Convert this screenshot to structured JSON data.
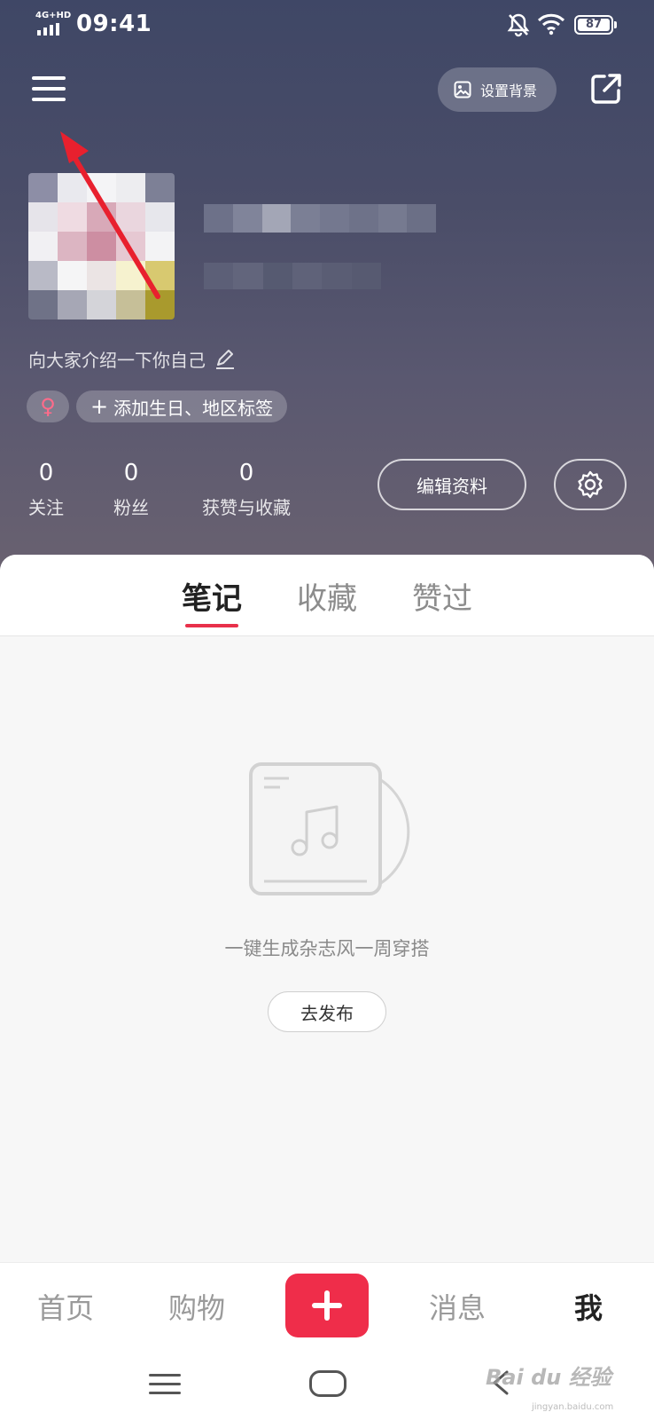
{
  "status_bar": {
    "network": "4G+HD",
    "time": "09:41",
    "battery": "87",
    "icons": [
      "mute-bell-icon",
      "wifi-icon",
      "battery-icon"
    ]
  },
  "header": {
    "menu_icon": "hamburger-menu-icon",
    "set_background_label": "设置背景",
    "share_icon": "share-external-icon"
  },
  "profile": {
    "bio": "向大家介绍一下你自己",
    "gender_symbol": "♀",
    "add_tags_label": "添加生日、地区标签",
    "stats": [
      {
        "value": "0",
        "label": "关注"
      },
      {
        "value": "0",
        "label": "粉丝"
      },
      {
        "value": "0",
        "label": "获赞与收藏"
      }
    ],
    "edit_label": "编辑资料",
    "settings_icon": "gear-icon"
  },
  "tabs": [
    {
      "label": "笔记",
      "active": true
    },
    {
      "label": "收藏",
      "active": false
    },
    {
      "label": "赞过",
      "active": false
    }
  ],
  "empty_state": {
    "icon": "music-album-icon",
    "text": "一键生成杂志风一周穿搭",
    "button_label": "去发布"
  },
  "bottom_nav": [
    {
      "label": "首页",
      "active": false
    },
    {
      "label": "购物",
      "active": false
    },
    {
      "label": "+",
      "active": false
    },
    {
      "label": "消息",
      "active": false
    },
    {
      "label": "我",
      "active": true
    }
  ],
  "watermark": {
    "text": "Bai du 经验",
    "sub": "jingyan.baidu.com"
  },
  "colors": {
    "accent": "#ef2d4a",
    "header_top": "#3f4766",
    "header_bottom": "#6a6270"
  }
}
